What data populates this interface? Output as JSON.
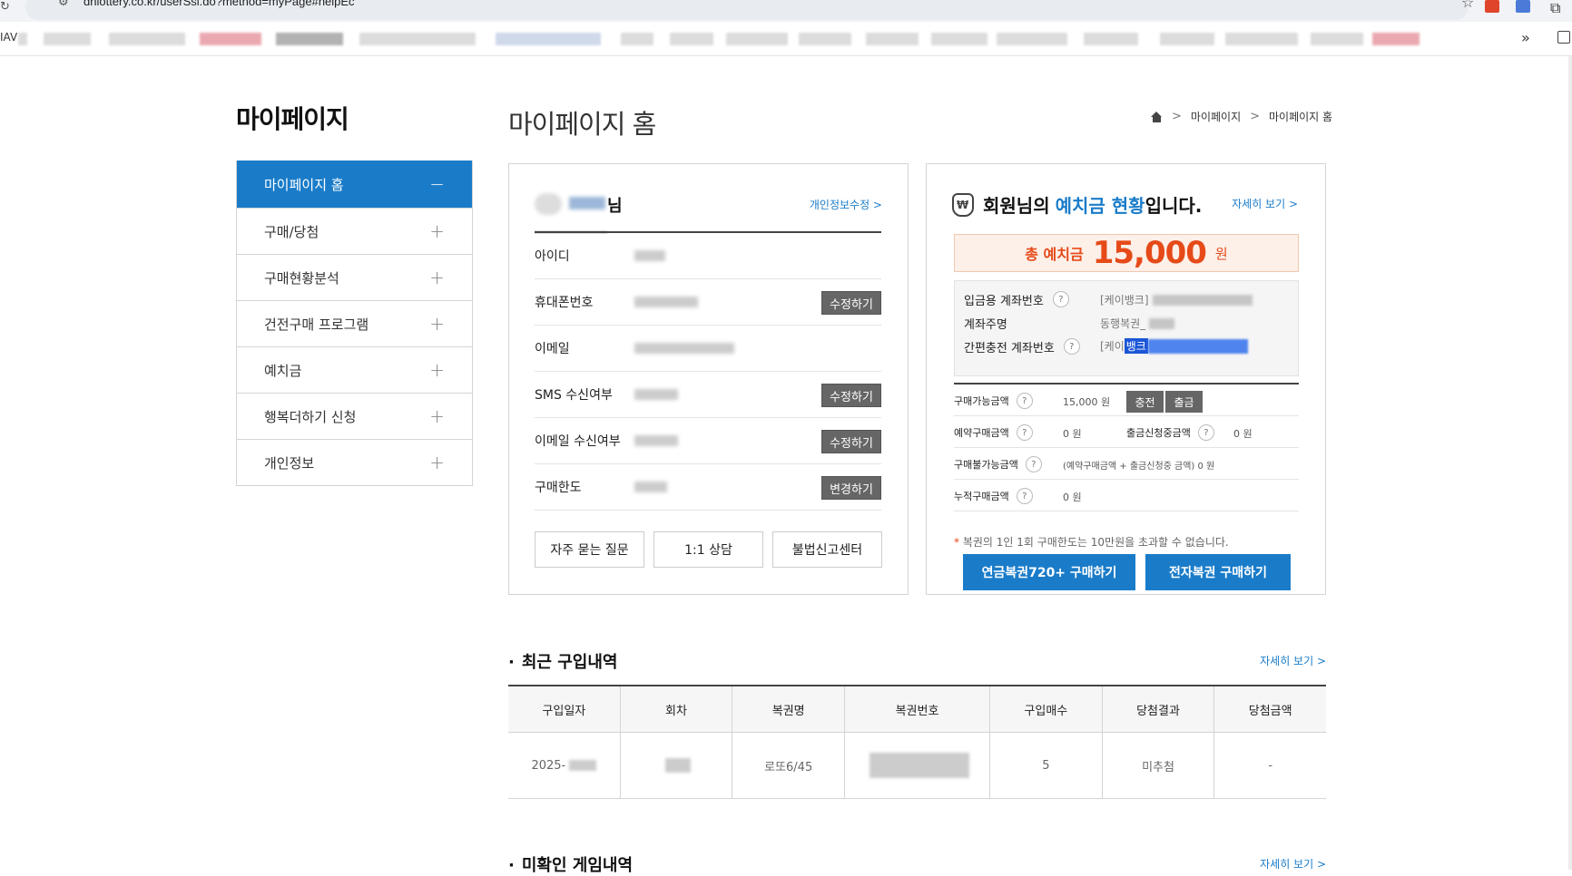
{
  "browser": {
    "url": "dhlottery.co.kr/userSsl.do?method=myPage#helpEc",
    "bookmark_first": "IAV"
  },
  "sidebar": {
    "title": "마이페이지",
    "items": [
      {
        "label": "마이페이지 홈",
        "sign": "−"
      },
      {
        "label": "구매/당첨",
        "sign": "+"
      },
      {
        "label": "구매현황분석",
        "sign": "+"
      },
      {
        "label": "건전구매 프로그램",
        "sign": "+"
      },
      {
        "label": "예치금",
        "sign": "+"
      },
      {
        "label": "행복더하기 신청",
        "sign": "+"
      },
      {
        "label": "개인정보",
        "sign": "+"
      }
    ]
  },
  "main": {
    "title": "마이페이지 홈",
    "breadcrumb": [
      "마이페이지",
      "마이페이지 홈"
    ],
    "separator": ">"
  },
  "user": {
    "suffix": "님",
    "edit_link": "개인정보수정 >",
    "rows": [
      {
        "label": "아이디",
        "button": ""
      },
      {
        "label": "휴대폰번호",
        "button": "수정하기"
      },
      {
        "label": "이메일",
        "button": ""
      },
      {
        "label": "SMS 수신여부",
        "button": "수정하기"
      },
      {
        "label": "이메일 수신여부",
        "button": "수정하기"
      },
      {
        "label": "구매한도",
        "button": "변경하기"
      }
    ],
    "buttons": [
      "자주 묻는 질문",
      "1:1 상담",
      "불법신고센터"
    ]
  },
  "deposit": {
    "title_pre": "회원님의",
    "title_blue": "예치금 현황",
    "title_post": "입니다.",
    "detail_link": "자세히 보기 >",
    "total_label": "총 예치금",
    "total_amount": "15,000",
    "total_unit": "원",
    "account_rows": [
      {
        "label": "입금용 계좌번호",
        "value_prefix": "[케이뱅크]"
      },
      {
        "label": "계좌주명",
        "value_prefix": "동행복권_"
      },
      {
        "label": "간편충전 계좌번호",
        "value_prefix": "[케이",
        "value_highlight": "뱅크"
      }
    ],
    "available_label": "구매가능금액",
    "available_value": "15,000 원",
    "charge_button": "충전",
    "withdraw_button": "출금",
    "reserved_label": "예약구매금액",
    "reserved_value": "0 원",
    "withdraw_pending_label": "출금신청중금액",
    "withdraw_pending_value": "0 원",
    "unavailable_label": "구매불가능금액",
    "unavailable_value": "(예약구매금액 + 출금신청중 금액)  0 원",
    "cumulative_label": "누적구매금액",
    "cumulative_value": "0 원",
    "note_star": "*",
    "note": "복권의 1인 1회 구매한도는 10만원을 초과할 수 없습니다.",
    "buy_pension": "연금복권720+ 구매하기",
    "buy_electronic": "전자복권 구매하기",
    "question_mark": "?"
  },
  "recent": {
    "title": "최근 구입내역",
    "detail_link": "자세히 보기 >",
    "headers": [
      "구입일자",
      "회차",
      "복권명",
      "복권번호",
      "구입매수",
      "당첨결과",
      "당첨금액"
    ],
    "row": {
      "date": "2025-",
      "round": "",
      "name": "로또6/45",
      "number": "",
      "count": "5",
      "result": "미추첨",
      "prize": "-"
    }
  },
  "unconfirmed": {
    "title": "미확인 게임내역",
    "detail_link": "자세히 보기 >"
  },
  "colors": {
    "accent": "#1a7cc9",
    "total": "#e64a19",
    "button_dark": "#666666"
  }
}
